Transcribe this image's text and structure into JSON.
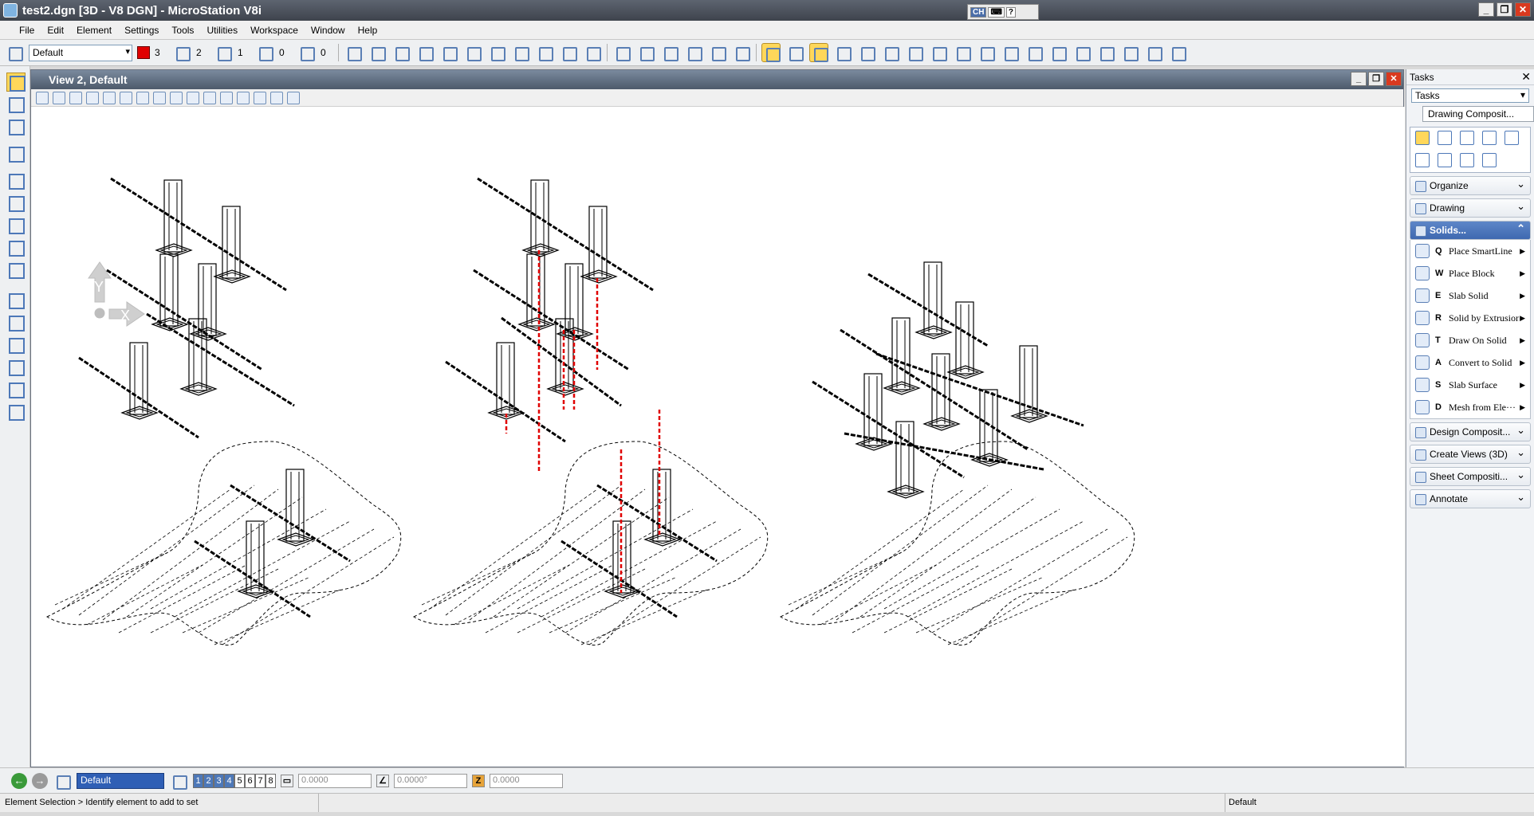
{
  "window": {
    "title": "test2.dgn [3D - V8 DGN] - MicroStation V8i",
    "lang": "CH"
  },
  "menu": [
    "File",
    "Edit",
    "Element",
    "Settings",
    "Tools",
    "Utilities",
    "Workspace",
    "Window",
    "Help"
  ],
  "attributes": {
    "level": "Default",
    "color_value": "3",
    "style_value": "2",
    "weight_value": "1",
    "transparency_value": "0",
    "priority_value": "0"
  },
  "view": {
    "title": "View 2, Default"
  },
  "bottom": {
    "level": "Default",
    "view_numbers": [
      "1",
      "2",
      "3",
      "4",
      "5",
      "6",
      "7",
      "8"
    ],
    "x": "0.0000",
    "angle": "0.0000°",
    "z": "0.0000"
  },
  "status": {
    "message": "Element Selection > Identify element to add to set",
    "level": "Default"
  },
  "tasks": {
    "header": "Tasks",
    "combo": "Tasks",
    "current": "Drawing Composit...",
    "sections_top": [
      "Organize",
      "Drawing"
    ],
    "open_section": "Solids...",
    "solids_items": [
      {
        "key": "Q",
        "label": "Place SmartLine"
      },
      {
        "key": "W",
        "label": "Place Block"
      },
      {
        "key": "E",
        "label": "Slab Solid"
      },
      {
        "key": "R",
        "label": "Solid by Extrusion"
      },
      {
        "key": "T",
        "label": "Draw On Solid"
      },
      {
        "key": "A",
        "label": "Convert to Solid"
      },
      {
        "key": "S",
        "label": "Slab Surface"
      },
      {
        "key": "D",
        "label": "Mesh from Ele···"
      }
    ],
    "sections_bottom": [
      "Design Composit...",
      "Create Views (3D)",
      "Sheet Compositi...",
      "Annotate"
    ]
  },
  "triad": {
    "y": "Y",
    "x": "X"
  }
}
